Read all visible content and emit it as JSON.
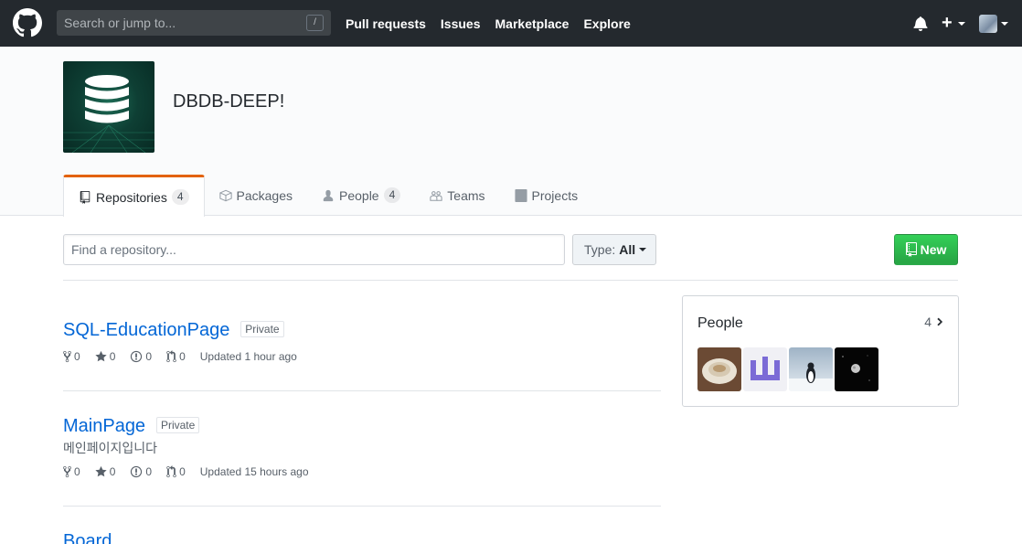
{
  "header": {
    "search_placeholder": "Search or jump to...",
    "search_key": "/",
    "nav": [
      "Pull requests",
      "Issues",
      "Marketplace",
      "Explore"
    ]
  },
  "org": {
    "name": "DBDB-DEEP!",
    "tabs": [
      {
        "label": "Repositories",
        "count": "4",
        "icon": "repo-icon",
        "selected": true
      },
      {
        "label": "Packages",
        "count": "",
        "icon": "package-icon",
        "selected": false
      },
      {
        "label": "People",
        "count": "4",
        "icon": "person-icon",
        "selected": false
      },
      {
        "label": "Teams",
        "count": "",
        "icon": "people-icon",
        "selected": false
      },
      {
        "label": "Projects",
        "count": "",
        "icon": "project-icon",
        "selected": false
      }
    ]
  },
  "filters": {
    "find_placeholder": "Find a repository...",
    "type_label": "Type:",
    "type_value": "All",
    "new_label": "New"
  },
  "repos": [
    {
      "name": "SQL-EducationPage",
      "badge": "Private",
      "description": "",
      "forks": "0",
      "stars": "0",
      "issues": "0",
      "prs": "0",
      "updated": "Updated 1 hour ago"
    },
    {
      "name": "MainPage",
      "badge": "Private",
      "description": "메인페이지입니다",
      "forks": "0",
      "stars": "0",
      "issues": "0",
      "prs": "0",
      "updated": "Updated 15 hours ago"
    },
    {
      "name": "Board",
      "badge": "",
      "description": "",
      "forks": "",
      "stars": "",
      "issues": "",
      "prs": "",
      "updated": ""
    }
  ],
  "people": {
    "title": "People",
    "count": "4"
  },
  "colors": {
    "header_bg": "#24292e",
    "link": "#0366d6",
    "tab_accent": "#e36209",
    "new_button": "#28a745"
  }
}
